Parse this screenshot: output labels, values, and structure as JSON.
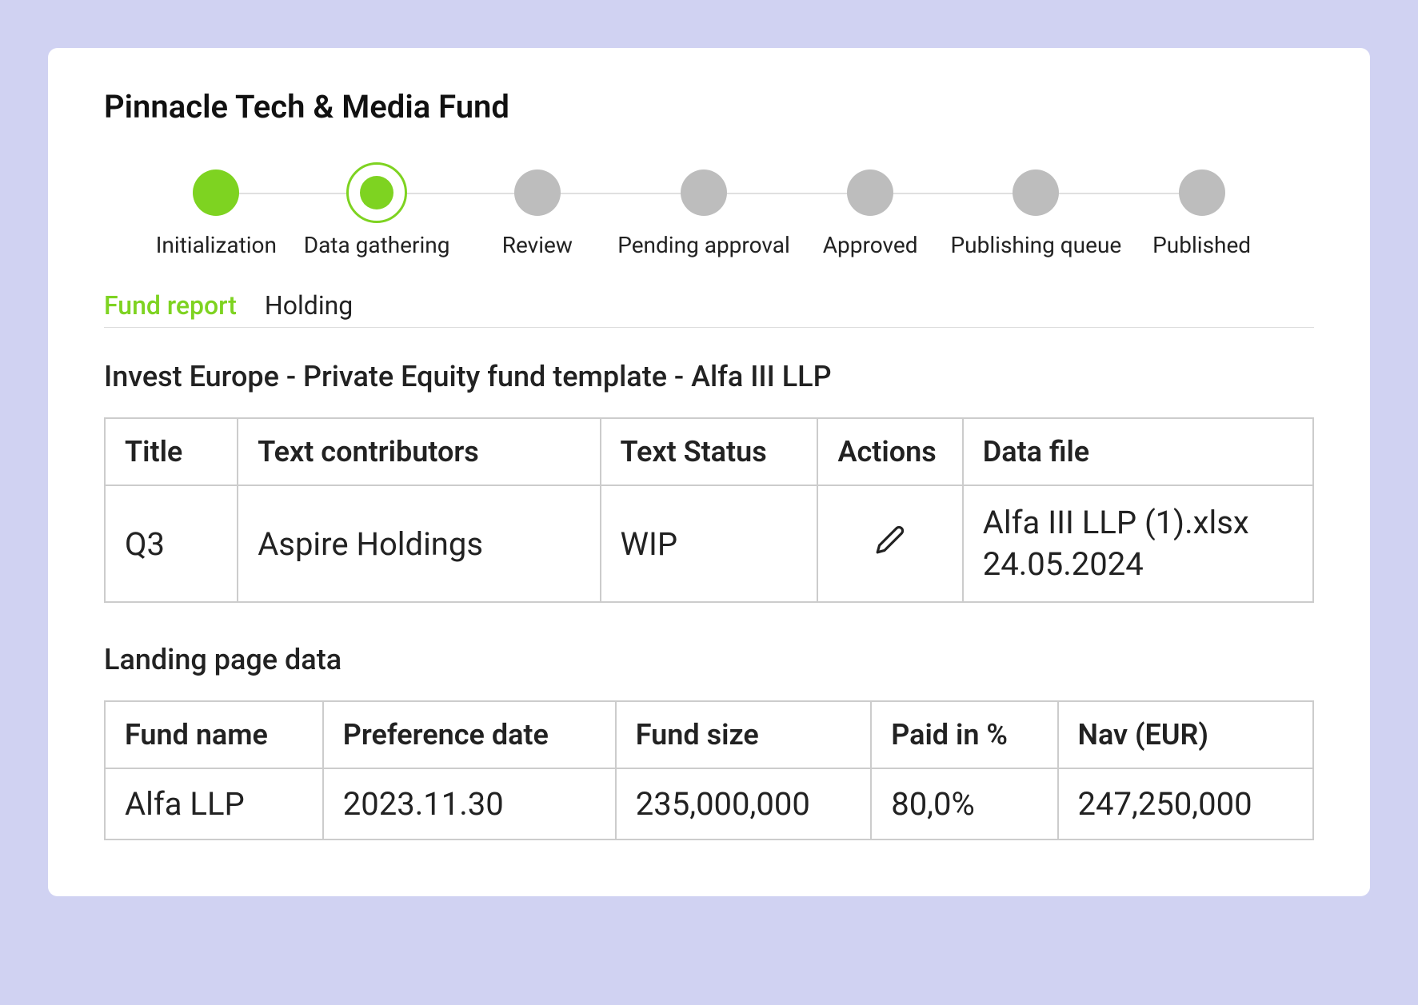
{
  "page_title": "Pinnacle Tech & Media Fund",
  "stepper": {
    "steps": [
      {
        "label": "Initialization",
        "state": "completed"
      },
      {
        "label": "Data gathering",
        "state": "current"
      },
      {
        "label": "Review",
        "state": "pending"
      },
      {
        "label": "Pending approval",
        "state": "pending"
      },
      {
        "label": "Approved",
        "state": "pending"
      },
      {
        "label": "Publishing queue",
        "state": "pending"
      },
      {
        "label": "Published",
        "state": "pending"
      }
    ]
  },
  "tabs": [
    {
      "label": "Fund report",
      "active": true
    },
    {
      "label": "Holding",
      "active": false
    }
  ],
  "template_section": {
    "title": "Invest Europe - Private Equity fund template - Alfa III LLP",
    "headers": [
      "Title",
      "Text contributors",
      "Text Status",
      "Actions",
      "Data file"
    ],
    "rows": [
      {
        "title": "Q3",
        "contributors": "Aspire Holdings",
        "status": "WIP",
        "data_file_name": "Alfa III LLP (1).xlsx",
        "data_file_date": "24.05.2024"
      }
    ]
  },
  "landing_section": {
    "title": "Landing page data",
    "headers": [
      "Fund name",
      "Preference date",
      "Fund size",
      "Paid in %",
      "Nav (EUR)"
    ],
    "rows": [
      {
        "fund_name": "Alfa LLP",
        "preference_date": "2023.11.30",
        "fund_size": "235,000,000",
        "paid_in": "80,0%",
        "nav": "247,250,000"
      }
    ]
  }
}
